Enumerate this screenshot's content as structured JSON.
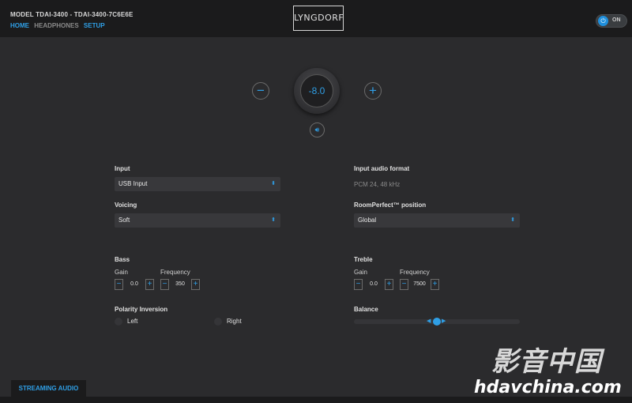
{
  "header": {
    "model": "MODEL TDAI-3400 - TDAI-3400-7C6E6E",
    "nav": [
      "HOME",
      "HEADPHONES",
      "SETUP"
    ],
    "logo": "LYNGDORF",
    "power_label": "ON"
  },
  "volume": {
    "value": "-8.0",
    "minus": "−",
    "plus": "+",
    "mute_icon": "speaker-icon"
  },
  "left": {
    "input_label": "Input",
    "input_value": "USB Input",
    "voicing_label": "Voicing",
    "voicing_value": "Soft",
    "bass_label": "Bass",
    "gain_label": "Gain",
    "freq_label": "Frequency",
    "bass_gain": "0.0",
    "bass_freq": "350",
    "polarity_label": "Polarity Inversion",
    "left_label": "Left",
    "right_label": "Right"
  },
  "right": {
    "format_label": "Input audio format",
    "format_value": "PCM 24, 48 kHz",
    "rp_label": "RoomPerfect™ position",
    "rp_value": "Global",
    "treble_label": "Treble",
    "gain_label": "Gain",
    "freq_label": "Frequency",
    "treble_gain": "0.0",
    "treble_freq": "7500",
    "balance_label": "Balance",
    "balance_position": 0.5
  },
  "footer": {
    "stream_tab": "STREAMING AUDIO"
  },
  "watermark": {
    "chars": "影音中国",
    "site": "hdavchina.com"
  },
  "colors": {
    "accent": "#2f9fe6",
    "bg": "#2b2b2d",
    "header": "#1b1b1c"
  }
}
